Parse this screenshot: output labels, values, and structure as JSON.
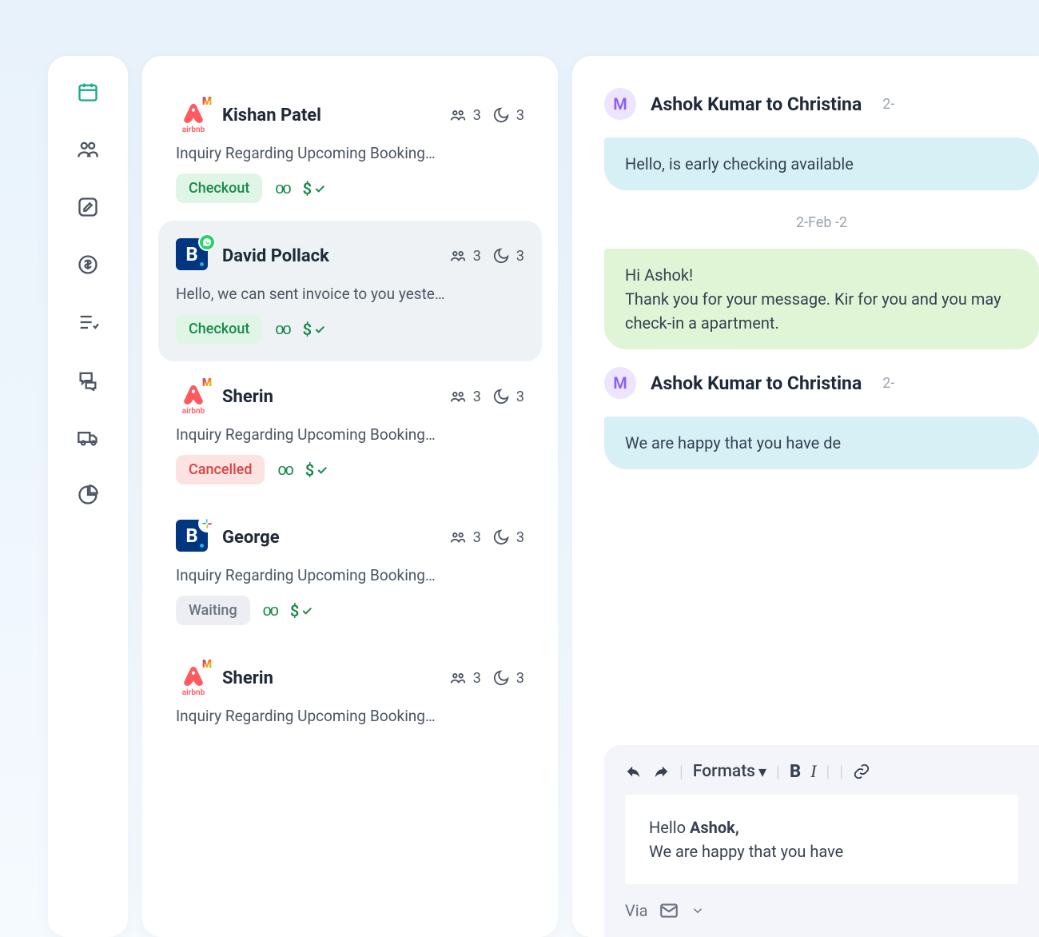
{
  "nav": {
    "items": [
      {
        "name": "calendar-icon"
      },
      {
        "name": "guests-icon"
      },
      {
        "name": "edit-icon"
      },
      {
        "name": "dollar-icon"
      },
      {
        "name": "tasks-icon"
      },
      {
        "name": "chat-icon"
      },
      {
        "name": "parcel-icon"
      },
      {
        "name": "pie-chart-icon"
      }
    ]
  },
  "inbox": [
    {
      "source": "airbnb",
      "corner": "gmail",
      "name": "Kishan Patel",
      "guests": "3",
      "nights": "3",
      "preview": "Inquiry Regarding Upcoming Booking…",
      "status": "Checkout",
      "status_style": "checkout",
      "voicemail": true,
      "paid": true,
      "selected": false
    },
    {
      "source": "booking",
      "corner": "whatsapp",
      "name": "David Pollack",
      "guests": "3",
      "nights": "3",
      "preview": "Hello, we can sent invoice to you yeste…",
      "status": "Checkout",
      "status_style": "checkout",
      "voicemail": true,
      "paid": true,
      "selected": true
    },
    {
      "source": "airbnb",
      "corner": "gmail",
      "name": "Sherin",
      "guests": "3",
      "nights": "3",
      "preview": "Inquiry Regarding Upcoming Booking…",
      "status": "Cancelled",
      "status_style": "cancelled",
      "voicemail": true,
      "paid": true,
      "selected": false
    },
    {
      "source": "booking",
      "corner": "slack",
      "name": "George",
      "guests": "3",
      "nights": "3",
      "preview": "Inquiry Regarding Upcoming Booking…",
      "status": "Waiting",
      "status_style": "waiting",
      "voicemail": true,
      "paid": true,
      "selected": false
    },
    {
      "source": "airbnb",
      "corner": "gmail",
      "name": "Sherin",
      "guests": "3",
      "nights": "3",
      "preview": "Inquiry Regarding Upcoming Booking…",
      "status": "",
      "status_style": "",
      "voicemail": false,
      "paid": false,
      "selected": false
    }
  ],
  "chat": {
    "avatar_initial": "M",
    "header1_fromto": "Ashok Kumar to Christina",
    "header1_time": "2-",
    "bubble1": "Hello, is early checking available",
    "date_sep": "2-Feb -2",
    "bubble2": "Hi Ashok!\nThank you for your message. Kir for you and you may check-in a apartment.",
    "header2_fromto": "Ashok Kumar to Christina",
    "header2_time": "2-",
    "bubble3": "We are happy that you have de",
    "toolbar_formats": "Formats",
    "compose_greet": "Hello ",
    "compose_name": "Ashok,",
    "compose_body": "We are happy that you have ",
    "via_label": "Via"
  }
}
